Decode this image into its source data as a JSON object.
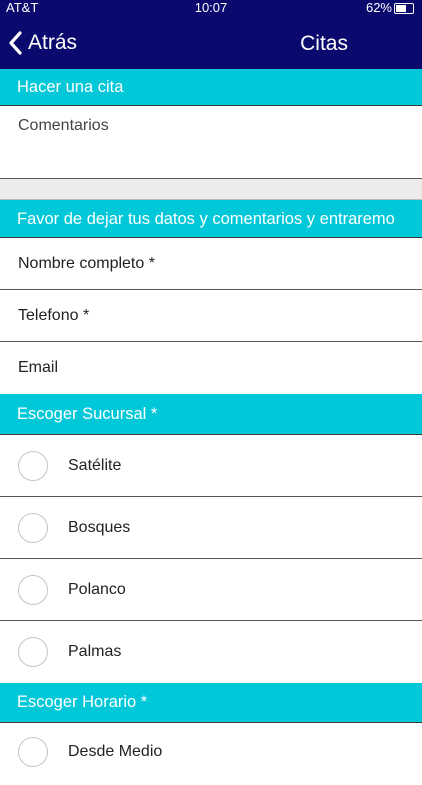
{
  "status_bar": {
    "carrier": "AT&T",
    "time": "10:07",
    "battery": "62%",
    "battery_level": 0.62
  },
  "nav": {
    "back_label": "Atrás",
    "title": "Citas"
  },
  "appointment_section": {
    "header": "Hacer una cita",
    "comments_placeholder": "Comentarios"
  },
  "contact_section": {
    "header": "Favor de dejar tus datos y comentarios y entraremo",
    "full_name_placeholder": "Nombre completo *",
    "phone_placeholder": "Telefono *",
    "email_placeholder": "Email"
  },
  "branch_section": {
    "header": "Escoger Sucursal *",
    "options": [
      "Satélite",
      "Bosques",
      "Polanco",
      "Palmas"
    ]
  },
  "schedule_section": {
    "header": "Escoger Horario *",
    "first_option": "Desde Medio"
  }
}
